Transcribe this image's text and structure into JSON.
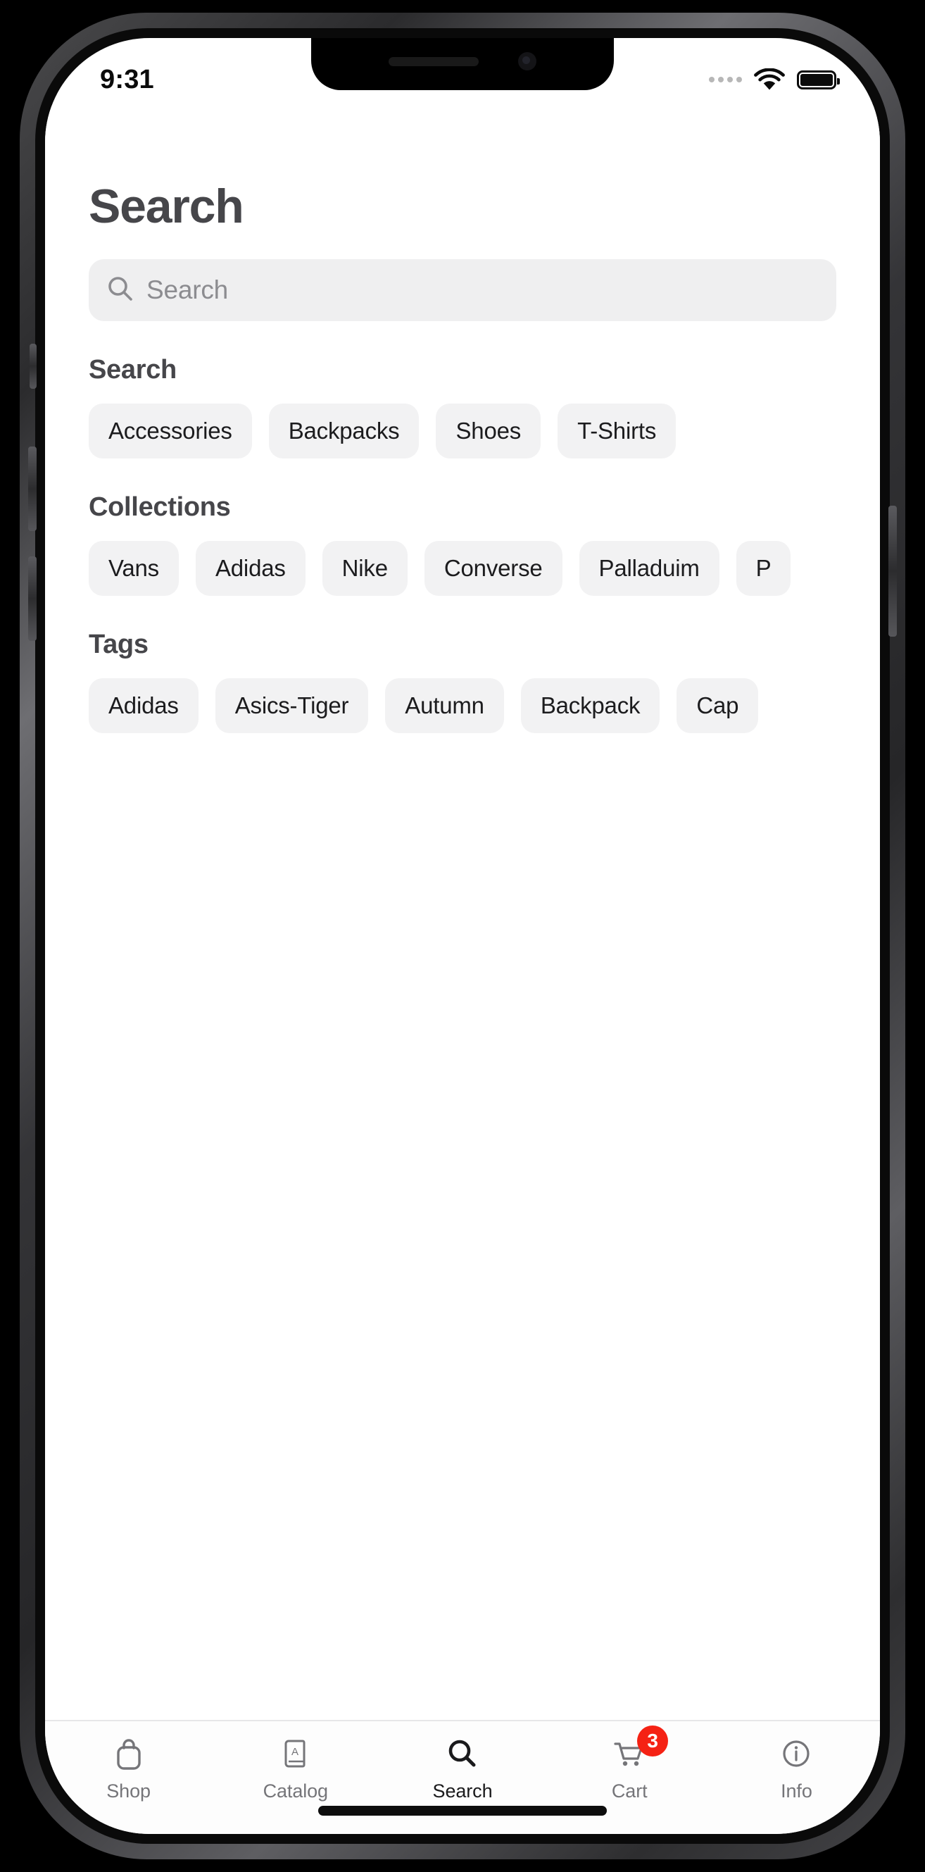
{
  "status_bar": {
    "time": "9:31",
    "signal_icon": "signal-dots-icon",
    "wifi_icon": "wifi-icon",
    "battery_icon": "battery-full-icon"
  },
  "header": {
    "title": "Search"
  },
  "search": {
    "icon": "search-icon",
    "value": "",
    "placeholder": "Search"
  },
  "sections": [
    {
      "title": "Search",
      "chips": [
        "Accessories",
        "Backpacks",
        "Shoes",
        "T-Shirts"
      ]
    },
    {
      "title": "Collections",
      "chips": [
        "Vans",
        "Adidas",
        "Nike",
        "Converse",
        "Palladuim",
        "P"
      ]
    },
    {
      "title": "Tags",
      "chips": [
        "Adidas",
        "Asics-Tiger",
        "Autumn",
        "Backpack",
        "Cap"
      ]
    }
  ],
  "tabbar": {
    "items": [
      {
        "label": "Shop",
        "icon": "shopping-bag-icon",
        "active": false
      },
      {
        "label": "Catalog",
        "icon": "book-icon",
        "active": false
      },
      {
        "label": "Search",
        "icon": "search-icon",
        "active": true
      },
      {
        "label": "Cart",
        "icon": "cart-icon",
        "active": false,
        "badge": "3"
      },
      {
        "label": "Info",
        "icon": "info-circle-icon",
        "active": false
      }
    ]
  },
  "colors": {
    "badge_red": "#f52214",
    "chip_bg": "#f2f2f3",
    "field_bg": "#efeff0",
    "heading": "#46464a",
    "muted": "#757579"
  }
}
